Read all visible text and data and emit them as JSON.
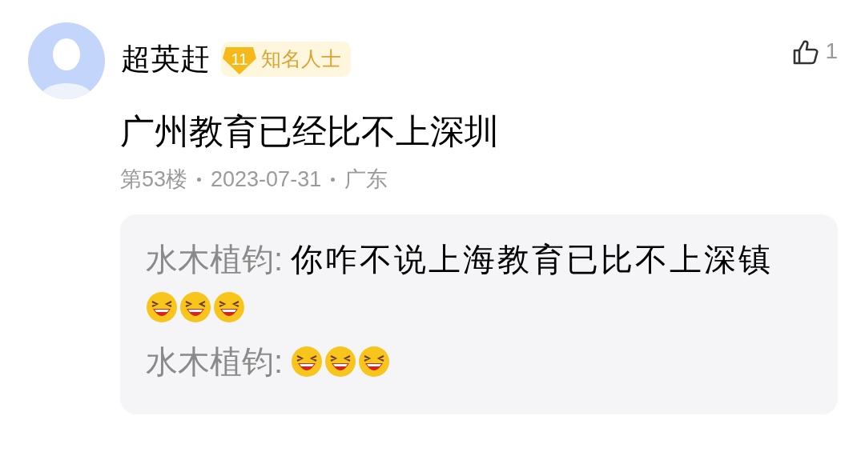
{
  "comment": {
    "author": "超英赶",
    "badge": {
      "level": "11",
      "title": "知名人士"
    },
    "likes": "1",
    "text": "广州教育已经比不上深圳",
    "meta": [
      "第53楼",
      "2023-07-31",
      "广东"
    ],
    "replies": [
      {
        "author": "水木植钧:",
        "text": "你咋不说上海教育已比不上深镇",
        "emojis": [
          {
            "kind": "laugh"
          },
          {
            "kind": "laugh"
          },
          {
            "kind": "laugh"
          }
        ]
      },
      {
        "author": "水木植钧:",
        "emojis": [
          {
            "kind": "laugh"
          },
          {
            "kind": "laugh"
          },
          {
            "kind": "laugh"
          }
        ]
      }
    ]
  }
}
